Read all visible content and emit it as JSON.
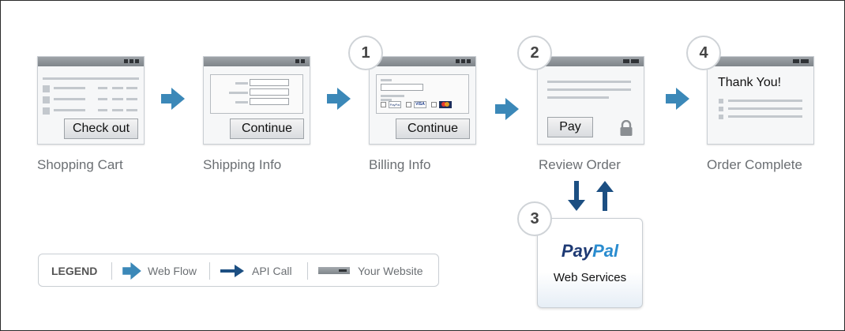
{
  "steps": [
    {
      "caption": "Shopping Cart",
      "button": "Check out"
    },
    {
      "caption": "Shipping Info",
      "button": "Continue"
    },
    {
      "number": "1",
      "caption": "Billing Info",
      "button": "Continue",
      "card_labels": [
        "PayPal",
        "VISA"
      ]
    },
    {
      "number": "2",
      "caption": "Review Order",
      "button": "Pay"
    },
    {
      "number": "4",
      "caption": "Order Complete",
      "heading": "Thank You!"
    }
  ],
  "service": {
    "number": "3",
    "logo_pay": "Pay",
    "logo_pal": "Pal",
    "label": "Web Services"
  },
  "legend": {
    "title": "LEGEND",
    "web_flow": "Web Flow",
    "api_call": "API Call",
    "your_website": "Your Website"
  },
  "colors": {
    "flow_arrow": "#3b88b8",
    "api_arrow": "#1c4f82",
    "window_bar": "#8a9095"
  },
  "icons": {
    "flow": "web-flow-arrow-icon",
    "api": "api-call-arrow-icon",
    "lock": "lock-icon"
  }
}
